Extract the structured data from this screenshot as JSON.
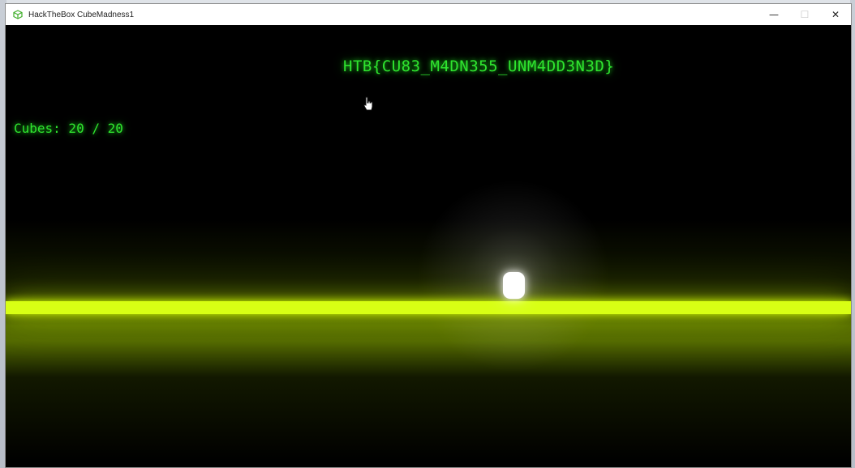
{
  "window": {
    "title": "HackTheBox CubeMadness1",
    "controls": {
      "minimize": "—",
      "maximize": "☐",
      "close": "✕"
    }
  },
  "game": {
    "flag_text": "HTB{CU83_M4DN355_UNM4DD3N3D}",
    "cubes_label": "Cubes: 20 / 20",
    "colors": {
      "hud_text": "#2fe52f",
      "floor": "#d8ff14",
      "player": "#ffffff",
      "background": "#000000"
    },
    "icons": {
      "app": "green-cube-icon",
      "cursor": "hand-pointer-icon"
    }
  }
}
